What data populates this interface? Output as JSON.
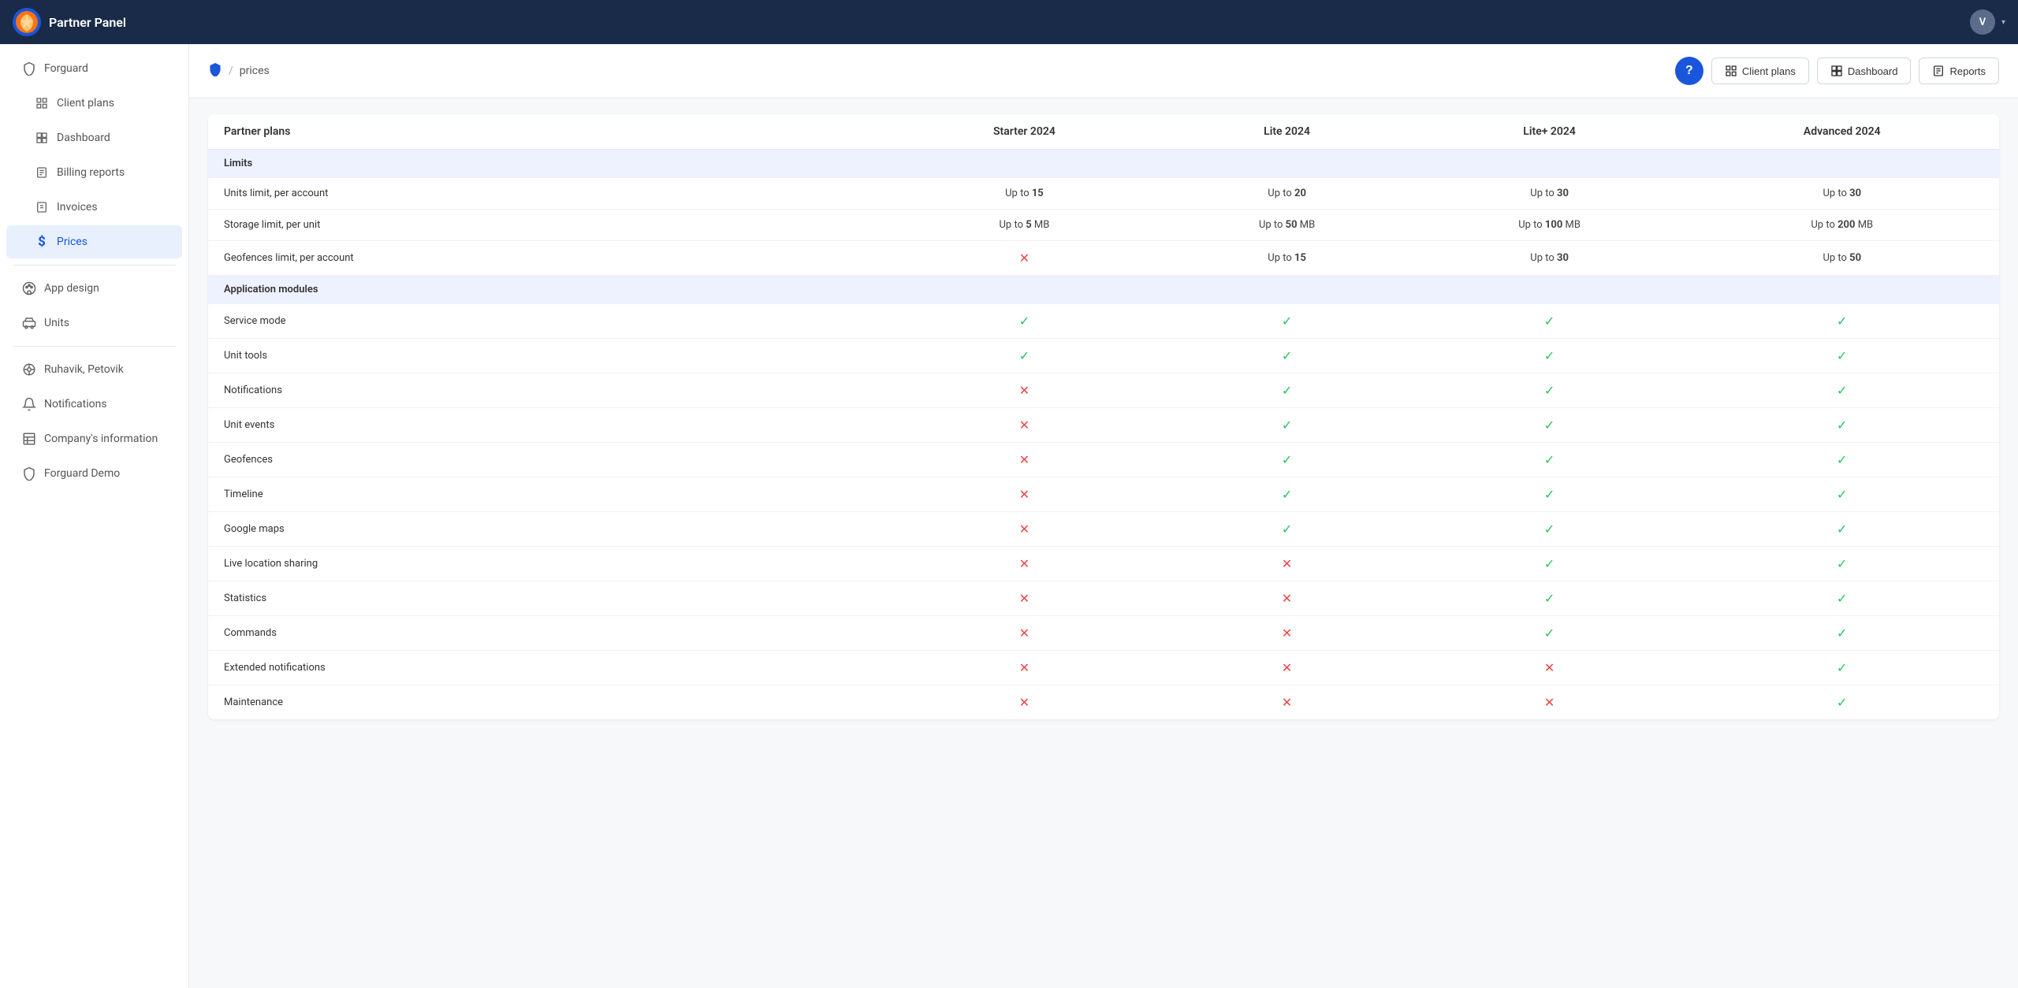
{
  "app": {
    "title": "Partner Panel",
    "avatar_initial": "V"
  },
  "sidebar": {
    "top_item": "Forguard",
    "items": [
      {
        "id": "client-plans",
        "label": "Client plans",
        "icon": "grid"
      },
      {
        "id": "dashboard",
        "label": "Dashboard",
        "icon": "dashboard"
      },
      {
        "id": "billing-reports",
        "label": "Billing reports",
        "icon": "report"
      },
      {
        "id": "invoices",
        "label": "Invoices",
        "icon": "invoice"
      },
      {
        "id": "prices",
        "label": "Prices",
        "icon": "dollar",
        "active": true
      }
    ],
    "items2": [
      {
        "id": "app-design",
        "label": "App design",
        "icon": "palette"
      },
      {
        "id": "units",
        "label": "Units",
        "icon": "car"
      }
    ],
    "items3": [
      {
        "id": "ruhavik",
        "label": "Ruhavik, Petovik",
        "icon": "wheel"
      },
      {
        "id": "notifications",
        "label": "Notifications",
        "icon": "bell"
      },
      {
        "id": "company-info",
        "label": "Company's information",
        "icon": "table"
      },
      {
        "id": "forguard-demo",
        "label": "Forguard Demo",
        "icon": "shield"
      }
    ]
  },
  "breadcrumb": {
    "home": "forguard-shield",
    "separator": "/",
    "current": "prices"
  },
  "header_buttons": {
    "help": "?",
    "client_plans": "Client plans",
    "dashboard": "Dashboard",
    "reports": "Reports"
  },
  "table": {
    "col_feature": "Partner plans",
    "col_starter": "Starter 2024",
    "col_lite": "Lite 2024",
    "col_lite_plus": "Lite+ 2024",
    "col_advanced": "Advanced 2024",
    "sections": [
      {
        "name": "Limits",
        "rows": [
          {
            "feature": "Units limit, per account",
            "starter": "Up to <b>15</b>",
            "lite": "Up to <b>20</b>",
            "lite_plus": "Up to <b>30</b>",
            "advanced": "Up to <b>30</b>"
          },
          {
            "feature": "Storage limit, per unit",
            "starter": "Up to <b>5</b> MB",
            "lite": "Up to <b>50</b> MB",
            "lite_plus": "Up to <b>100</b> MB",
            "advanced": "Up to <b>200</b> MB"
          },
          {
            "feature": "Geofences limit, per account",
            "starter": "cross",
            "lite": "Up to <b>15</b>",
            "lite_plus": "Up to <b>30</b>",
            "advanced": "Up to <b>50</b>"
          }
        ]
      },
      {
        "name": "Application modules",
        "rows": [
          {
            "feature": "Service mode",
            "starter": "check",
            "lite": "check",
            "lite_plus": "check",
            "advanced": "check"
          },
          {
            "feature": "Unit tools",
            "starter": "check",
            "lite": "check",
            "lite_plus": "check",
            "advanced": "check"
          },
          {
            "feature": "Notifications",
            "starter": "cross",
            "lite": "check",
            "lite_plus": "check",
            "advanced": "check"
          },
          {
            "feature": "Unit events",
            "starter": "cross",
            "lite": "check",
            "lite_plus": "check",
            "advanced": "check"
          },
          {
            "feature": "Geofences",
            "starter": "cross",
            "lite": "check",
            "lite_plus": "check",
            "advanced": "check"
          },
          {
            "feature": "Timeline",
            "starter": "cross",
            "lite": "check",
            "lite_plus": "check",
            "advanced": "check"
          },
          {
            "feature": "Google maps",
            "starter": "cross",
            "lite": "check",
            "lite_plus": "check",
            "advanced": "check"
          },
          {
            "feature": "Live location sharing",
            "starter": "cross",
            "lite": "cross",
            "lite_plus": "check",
            "advanced": "check"
          },
          {
            "feature": "Statistics",
            "starter": "cross",
            "lite": "cross",
            "lite_plus": "check",
            "advanced": "check"
          },
          {
            "feature": "Commands",
            "starter": "cross",
            "lite": "cross",
            "lite_plus": "check",
            "advanced": "check"
          },
          {
            "feature": "Extended notifications",
            "starter": "cross",
            "lite": "cross",
            "lite_plus": "cross",
            "advanced": "check"
          },
          {
            "feature": "Maintenance",
            "starter": "cross",
            "lite": "cross",
            "lite_plus": "cross",
            "advanced": "check"
          }
        ]
      }
    ]
  }
}
